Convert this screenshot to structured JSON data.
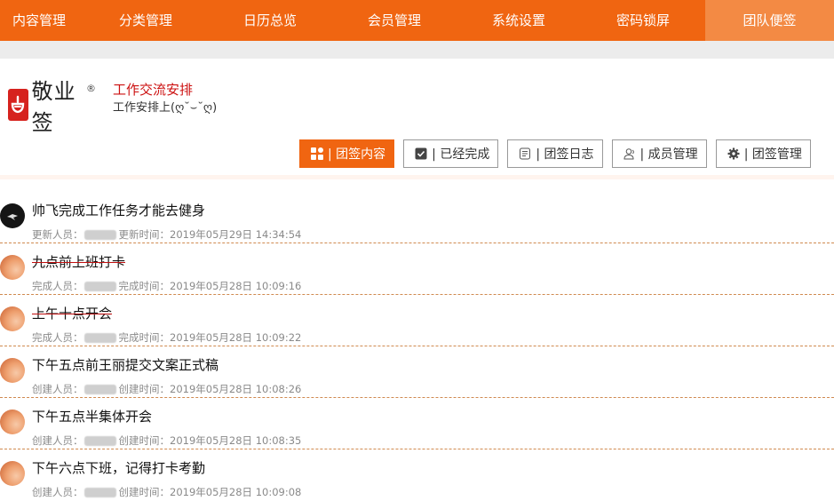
{
  "nav": {
    "items": [
      "内容管理",
      "分类管理",
      "日历总览",
      "会员管理",
      "系统设置",
      "密码锁屏",
      "团队便签"
    ],
    "active_index": 6
  },
  "logo": {
    "text": "敬业签",
    "reg_mark": "®"
  },
  "team": {
    "name": "工作交流安排",
    "description": "工作安排上(ღ˘⌣˘ღ)"
  },
  "toolbar": {
    "buttons": [
      {
        "label": "| 团签内容",
        "icon": "grid-icon",
        "active": true
      },
      {
        "label": "| 已经完成",
        "icon": "checkbox-icon",
        "active": false
      },
      {
        "label": "| 团签日志",
        "icon": "log-icon",
        "active": false
      },
      {
        "label": "| 成员管理",
        "icon": "users-icon",
        "active": false
      },
      {
        "label": "| 团签管理",
        "icon": "gear-icon",
        "active": false
      }
    ]
  },
  "colors": {
    "brand": "#f06511",
    "nav_active": "#f38a44",
    "strike": "#c01010",
    "logo_red": "#d6221e"
  },
  "entries": [
    {
      "title": "帅飞完成工作任务才能去健身",
      "completed": false,
      "person_label": "更新人员：",
      "time_label": "更新时间：",
      "time": "2019年05月29日 14:34:54",
      "avatar": "dark"
    },
    {
      "title": "九点前上班打卡",
      "completed": true,
      "person_label": "完成人员：",
      "time_label": "完成时间：",
      "time": "2019年05月28日 10:09:16",
      "avatar": "peach"
    },
    {
      "title": "上午十点开会",
      "completed": true,
      "person_label": "完成人员：",
      "time_label": "完成时间：",
      "time": "2019年05月28日 10:09:22",
      "avatar": "peach"
    },
    {
      "title": "下午五点前王丽提交文案正式稿",
      "completed": false,
      "person_label": "创建人员：",
      "time_label": "创建时间：",
      "time": "2019年05月28日 10:08:26",
      "avatar": "peach"
    },
    {
      "title": "下午五点半集体开会",
      "completed": false,
      "person_label": "创建人员：",
      "time_label": "创建时间：",
      "time": "2019年05月28日 10:08:35",
      "avatar": "peach"
    },
    {
      "title": "下午六点下班，记得打卡考勤",
      "completed": false,
      "person_label": "创建人员：",
      "time_label": "创建时间：",
      "time": "2019年05月28日 10:09:08",
      "avatar": "peach"
    }
  ]
}
